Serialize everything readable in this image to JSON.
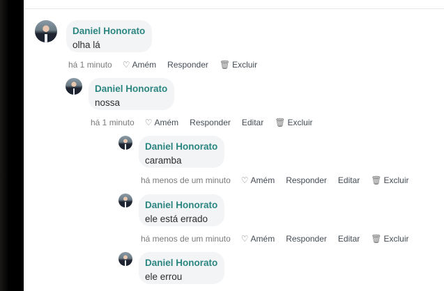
{
  "actions": {
    "amen": "Amém",
    "reply": "Responder",
    "edit": "Editar",
    "delete": "Excluir"
  },
  "comments": [
    {
      "author": "Daniel Honorato",
      "text": "olha lá",
      "time": "há 1 minuto"
    },
    {
      "author": "Daniel Honorato",
      "text": "nossa",
      "time": "há 1 minuto"
    },
    {
      "author": "Daniel Honorato",
      "text": "caramba",
      "time": "há menos de um minuto"
    },
    {
      "author": "Daniel Honorato",
      "text": "ele está errado",
      "time": "há menos de um minuto"
    },
    {
      "author": "Daniel Honorato",
      "text": "ele errou"
    }
  ]
}
